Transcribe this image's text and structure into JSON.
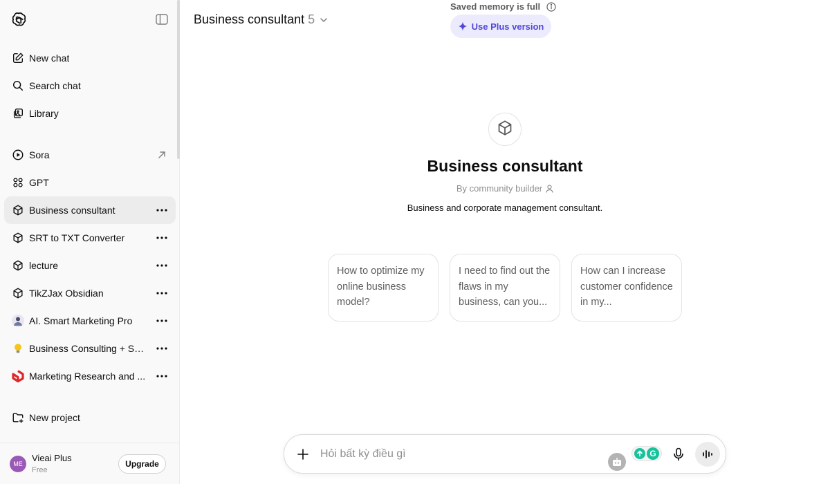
{
  "sidebar": {
    "top_items": [
      {
        "label": "New chat",
        "icon": "pencil-square-icon"
      },
      {
        "label": "Search chat",
        "icon": "search-icon"
      },
      {
        "label": "Library",
        "icon": "library-icon"
      }
    ],
    "sora": {
      "label": "Sora",
      "icon": "play-circle-icon"
    },
    "gpt": {
      "label": "GPT",
      "icon": "grid-icon"
    },
    "gpts": [
      {
        "label": "Business consultant",
        "icon": "cube-icon",
        "active": true
      },
      {
        "label": "SRT to TXT Converter",
        "icon": "cube-icon"
      },
      {
        "label": "lecture",
        "icon": "cube-icon"
      },
      {
        "label": "TikZJax Obsidian",
        "icon": "cube-icon"
      },
      {
        "label": "AI. Smart Marketing Pro",
        "icon": "avatar-image-icon"
      },
      {
        "label": "Business Consulting + Str...",
        "icon": "lightbulb-icon"
      },
      {
        "label": "Marketing Research and ...",
        "icon": "red-logo-icon"
      }
    ],
    "new_project": {
      "label": "New project",
      "icon": "folder-plus-icon"
    },
    "user": {
      "initials": "ME",
      "name": "Vieai Plus",
      "plan": "Free",
      "upgrade_label": "Upgrade",
      "avatar_color": "#9b59b6"
    }
  },
  "header": {
    "title": "Business consultant",
    "version": "5",
    "memory_notice": "Saved memory is full",
    "plus_button": "Use Plus version",
    "accent": "#5147d8"
  },
  "gpt": {
    "name": "Business consultant",
    "author": "By community builder",
    "description": "Business and corporate management consultant."
  },
  "starters": [
    "How to optimize my online business model?",
    "I need to find out the flaws in my business, can you...",
    "How can I increase customer confidence in my..."
  ],
  "composer": {
    "placeholder": "Hỏi bất kỳ điều gì",
    "extension_letter": "G",
    "extension_color": "#15c39a"
  }
}
